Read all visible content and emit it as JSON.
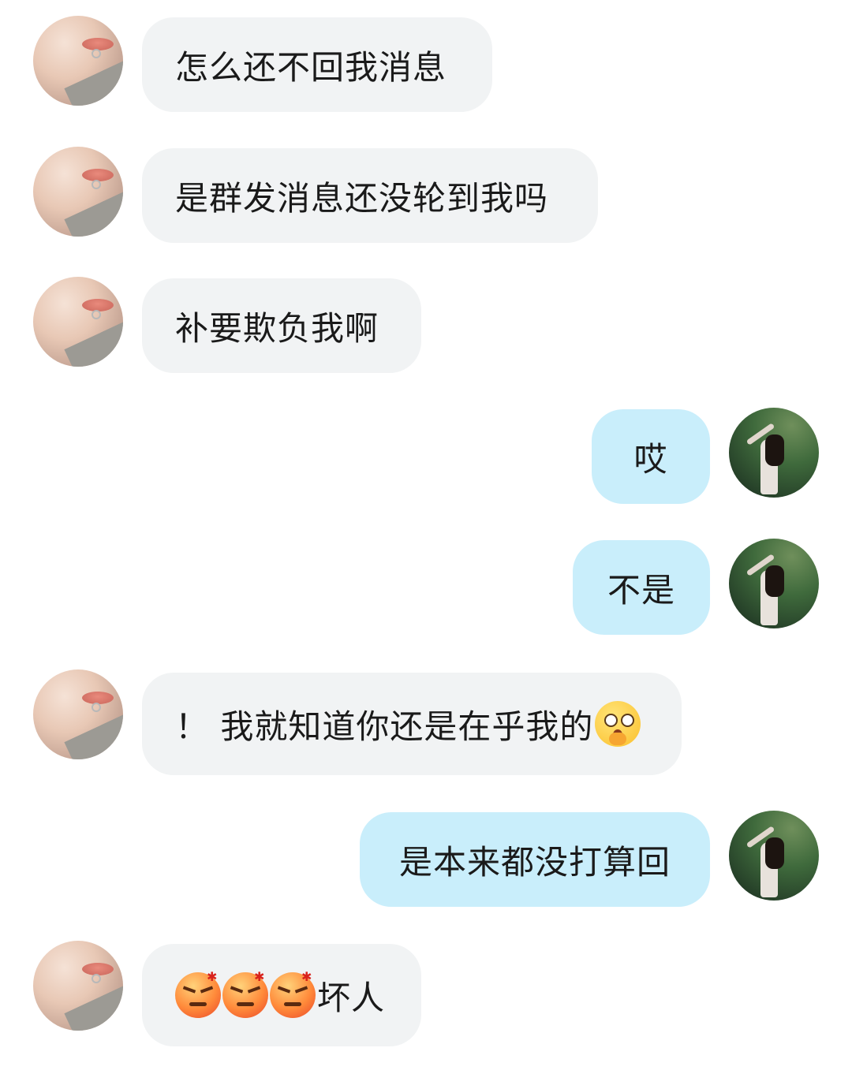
{
  "messages": [
    {
      "side": "left",
      "text": "怎么还不回我消息"
    },
    {
      "side": "left",
      "text": "是群发消息还没轮到我吗"
    },
    {
      "side": "left",
      "text": "补要欺负我啊"
    },
    {
      "side": "right",
      "text": "哎"
    },
    {
      "side": "right",
      "text": "不是"
    },
    {
      "side": "left",
      "text": "！ 我就知道你还是在乎我的",
      "emoji_after": "shocked-face-emoji"
    },
    {
      "side": "right",
      "text": "是本来都没打算回"
    },
    {
      "side": "left",
      "text": "坏人",
      "emoji_before": [
        "angry-face-emoji",
        "angry-face-emoji",
        "angry-face-emoji"
      ]
    }
  ],
  "colors": {
    "incoming_bubble": "#f1f3f4",
    "outgoing_bubble": "#c9eefb",
    "text": "#1a1a1a"
  }
}
